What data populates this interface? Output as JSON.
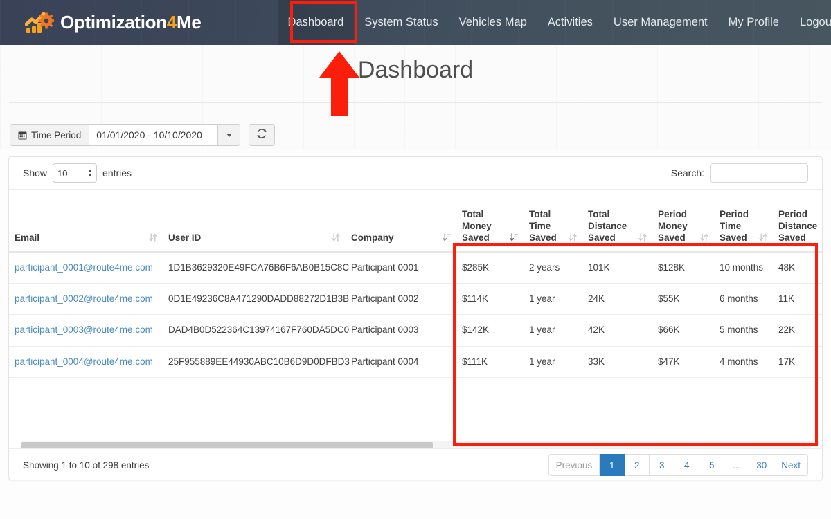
{
  "brand": {
    "name_part1": "Optimization",
    "name_accent": "4",
    "name_part2": "Me",
    "logo_icon": "chart-arrow-gear-logo"
  },
  "nav": {
    "items": [
      {
        "label": "Dashboard",
        "active": true
      },
      {
        "label": "System Status",
        "active": false
      },
      {
        "label": "Vehicles Map",
        "active": false
      },
      {
        "label": "Activities",
        "active": false
      },
      {
        "label": "User Management",
        "active": false
      },
      {
        "label": "My Profile",
        "active": false
      },
      {
        "label": "Logout",
        "active": false
      }
    ]
  },
  "page": {
    "title": "Dashboard"
  },
  "toolbar": {
    "time_period_label": "Time Period",
    "calendar_icon": "calendar-icon",
    "date_range": "01/01/2020 - 10/10/2020",
    "dropdown_icon": "caret-down-icon",
    "refresh_icon": "refresh-icon"
  },
  "table_controls": {
    "show_label": "Show",
    "entries_value": "10",
    "entries_suffix": "entries",
    "search_label": "Search:",
    "search_value": "",
    "search_placeholder": ""
  },
  "table": {
    "columns": [
      {
        "label": "Email",
        "sort": "both"
      },
      {
        "label": "User ID",
        "sort": "both"
      },
      {
        "label": "Company",
        "sort": "both"
      },
      {
        "label": "Total Money Saved",
        "sort": "desc"
      },
      {
        "label": "Total Time Saved",
        "sort": "both"
      },
      {
        "label": "Total Distance Saved",
        "sort": "both"
      },
      {
        "label": "Period Money Saved",
        "sort": "both"
      },
      {
        "label": "Period Time Saved",
        "sort": "both"
      },
      {
        "label": "Period Distance Saved",
        "sort": "both"
      }
    ],
    "rows": [
      {
        "email": "participant_0001@route4me.com",
        "user_id": "1D1B3629320E49FCA76B6F6AB0B15C8C",
        "company": "Participant 0001",
        "total_money_saved": "$285K",
        "total_time_saved": "2 years",
        "total_distance_saved": "101K",
        "period_money_saved": "$128K",
        "period_time_saved": "10 months",
        "period_distance_saved": "48K"
      },
      {
        "email": "participant_0002@route4me.com",
        "user_id": "0D1E49236C8A471290DADD88272D1B3B",
        "company": "Participant 0002",
        "total_money_saved": "$114K",
        "total_time_saved": "1 year",
        "total_distance_saved": "24K",
        "period_money_saved": "$55K",
        "period_time_saved": "6 months",
        "period_distance_saved": "11K"
      },
      {
        "email": "participant_0003@route4me.com",
        "user_id": "DAD4B0D522364C13974167F760DA5DC0",
        "company": "Participant 0003",
        "total_money_saved": "$142K",
        "total_time_saved": "1 year",
        "total_distance_saved": "42K",
        "period_money_saved": "$66K",
        "period_time_saved": "5 months",
        "period_distance_saved": "22K"
      },
      {
        "email": "participant_0004@route4me.com",
        "user_id": "25F955889EE44930ABC10B6D9D0DFBD3",
        "company": "Participant 0004",
        "total_money_saved": "$111K",
        "total_time_saved": "1 year",
        "total_distance_saved": "33K",
        "period_money_saved": "$47K",
        "period_time_saved": "4 months",
        "period_distance_saved": "17K"
      }
    ]
  },
  "footer": {
    "showing_info": "Showing 1 to 10 of 298 entries",
    "pagination": [
      {
        "label": "Previous",
        "state": "disabled"
      },
      {
        "label": "1",
        "state": "active"
      },
      {
        "label": "2",
        "state": "normal"
      },
      {
        "label": "3",
        "state": "normal"
      },
      {
        "label": "4",
        "state": "normal"
      },
      {
        "label": "5",
        "state": "normal"
      },
      {
        "label": "…",
        "state": "ellipsis"
      },
      {
        "label": "30",
        "state": "normal"
      },
      {
        "label": "Next",
        "state": "normal"
      }
    ]
  },
  "annotations": {
    "nav_highlight_color": "#fb1e0b",
    "columns_highlight_color": "#fb1e0b",
    "arrow_color": "#fb1e0b",
    "arrow_icon": "up-arrow-annotation"
  },
  "colors": {
    "navbar_left": "#3a4257",
    "navbar_right": "#47565f",
    "brand_accent": "#f7a21c",
    "saved_value": "#8bc34a",
    "link": "#4a8bc2",
    "pagination_active": "#2a7bbd"
  }
}
